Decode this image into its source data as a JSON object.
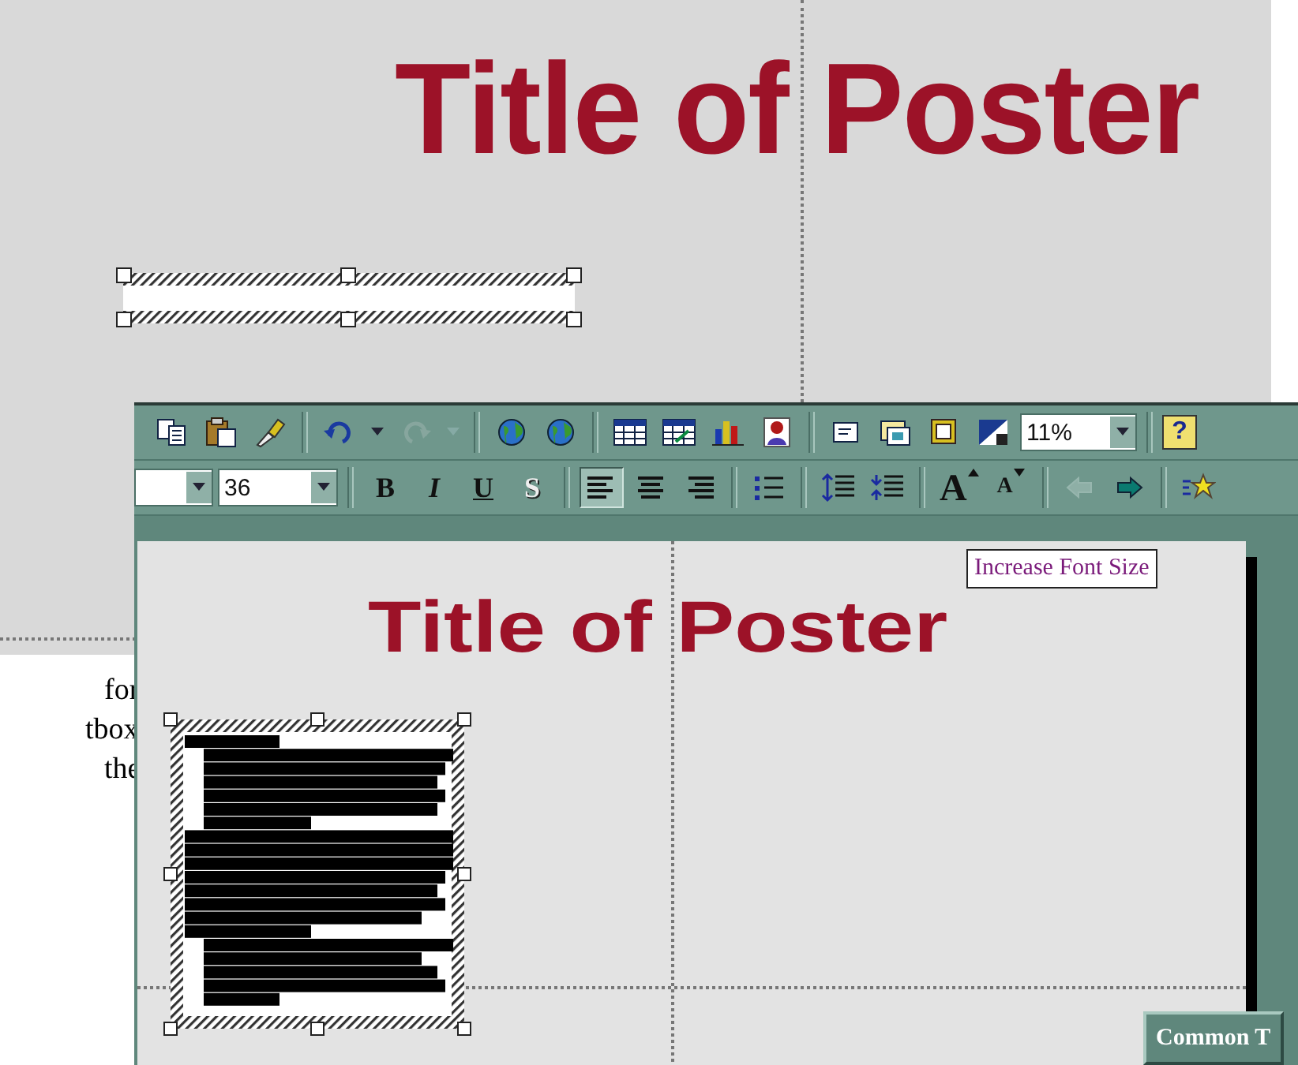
{
  "background_slide": {
    "title": "Title of Poster"
  },
  "side_text": [
    "for",
    "tbox",
    "the"
  ],
  "window": {
    "standard_toolbar": [
      {
        "kind": "copy",
        "disabled": false
      },
      {
        "kind": "paste",
        "disabled": false
      },
      {
        "kind": "brush",
        "disabled": false
      },
      {
        "kind": "separator"
      },
      {
        "kind": "undo",
        "disabled": false
      },
      {
        "kind": "dropdown",
        "disabled": false
      },
      {
        "kind": "redo",
        "disabled": true
      },
      {
        "kind": "dropdown",
        "disabled": true
      },
      {
        "kind": "separator"
      },
      {
        "kind": "globe",
        "disabled": false
      },
      {
        "kind": "globe",
        "disabled": false
      },
      {
        "kind": "separator"
      },
      {
        "kind": "table",
        "disabled": false
      },
      {
        "kind": "sheet",
        "disabled": false
      },
      {
        "kind": "chart",
        "disabled": false
      },
      {
        "kind": "figure",
        "disabled": false
      },
      {
        "kind": "separator"
      },
      {
        "kind": "page",
        "disabled": false
      },
      {
        "kind": "layout",
        "disabled": false
      },
      {
        "kind": "book",
        "disabled": false
      },
      {
        "kind": "contrast",
        "disabled": false
      },
      {
        "kind": "zoom_field",
        "value": "11%"
      },
      {
        "kind": "separator"
      },
      {
        "kind": "help",
        "label": "?"
      }
    ],
    "formatting_toolbar": [
      {
        "kind": "font_field"
      },
      {
        "kind": "size_field",
        "value": "36"
      },
      {
        "kind": "separator"
      },
      {
        "kind": "bold",
        "label": "B",
        "pressed": false
      },
      {
        "kind": "italic",
        "label": "I",
        "pressed": false
      },
      {
        "kind": "underline",
        "label": "U",
        "pressed": false
      },
      {
        "kind": "shadow",
        "label": "S",
        "pressed": false
      },
      {
        "kind": "separator"
      },
      {
        "kind": "align_left",
        "pressed": true
      },
      {
        "kind": "align_center",
        "pressed": false
      },
      {
        "kind": "align_right",
        "pressed": false
      },
      {
        "kind": "separator"
      },
      {
        "kind": "bullets",
        "disabled": false
      },
      {
        "kind": "separator"
      },
      {
        "kind": "spacing_up",
        "disabled": false
      },
      {
        "kind": "spacing_down",
        "disabled": false
      },
      {
        "kind": "separator"
      },
      {
        "kind": "grow",
        "label": "A",
        "disabled": false
      },
      {
        "kind": "shrink",
        "label": "A",
        "disabled": false
      },
      {
        "kind": "separator"
      },
      {
        "kind": "arrow_left",
        "disabled": true
      },
      {
        "kind": "arrow_right",
        "disabled": false
      },
      {
        "kind": "separator"
      },
      {
        "kind": "star",
        "disabled": false
      }
    ],
    "tooltip": "Increase Font Size",
    "slide": {
      "title": "Title of Poster"
    },
    "common_tasks_button": "Common T"
  }
}
